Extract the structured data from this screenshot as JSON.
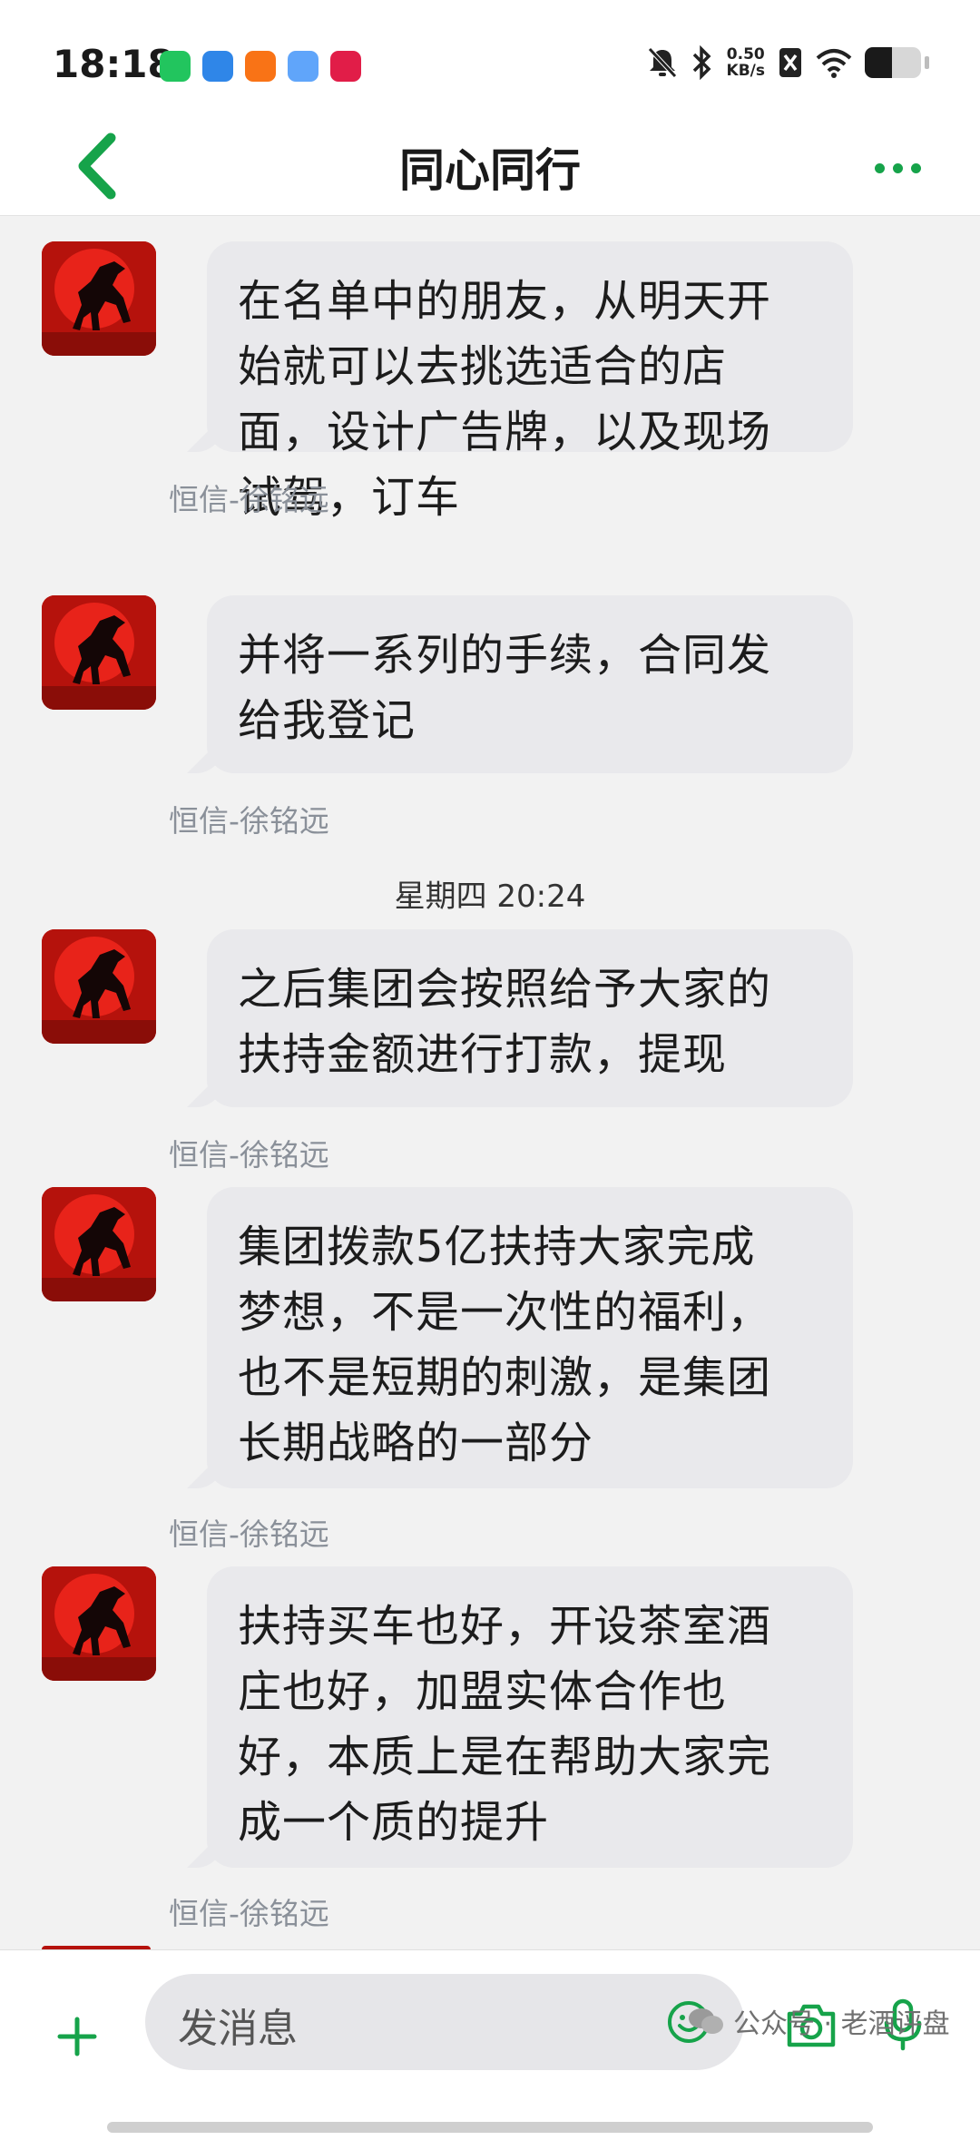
{
  "status_bar": {
    "time": "18:18",
    "net_speed_value": "0.50",
    "net_speed_unit": "KB/s",
    "battery_level": 0.48
  },
  "header": {
    "title": "同心同行"
  },
  "colors": {
    "accent": "#16a34a",
    "bubble": "#e9e9ec",
    "sender_name": "#8a9099"
  },
  "messages": [
    {
      "sender": "恒信-徐铭远",
      "lines": [
        "在名单中的朋友，从明天开",
        "始就可以去挑选适合的店",
        "面，设计广告牌，以及现场",
        "试驾，订车"
      ]
    },
    {
      "sender": "恒信-徐铭远",
      "lines": [
        "并将一系列的手续，合同发",
        "给我登记"
      ]
    },
    {
      "sender": "恒信-徐铭远",
      "lines": [
        "之后集团会按照给予大家的",
        "扶持金额进行打款，提现"
      ]
    },
    {
      "sender": "恒信-徐铭远",
      "lines": [
        "集团拨款5亿扶持大家完成",
        "梦想，不是一次性的福利，",
        "也不是短期的刺激，是集团",
        "长期战略的一部分"
      ]
    },
    {
      "sender": "恒信-徐铭远",
      "lines": [
        "扶持买车也好，开设茶室酒",
        "庄也好，加盟实体合作也",
        "好，本质上是在帮助大家完",
        "成一个质的提升"
      ]
    }
  ],
  "timestamp": "星期四 20:24",
  "composer": {
    "placeholder": "发消息"
  },
  "watermark": "公众号 · 老酒评盘"
}
